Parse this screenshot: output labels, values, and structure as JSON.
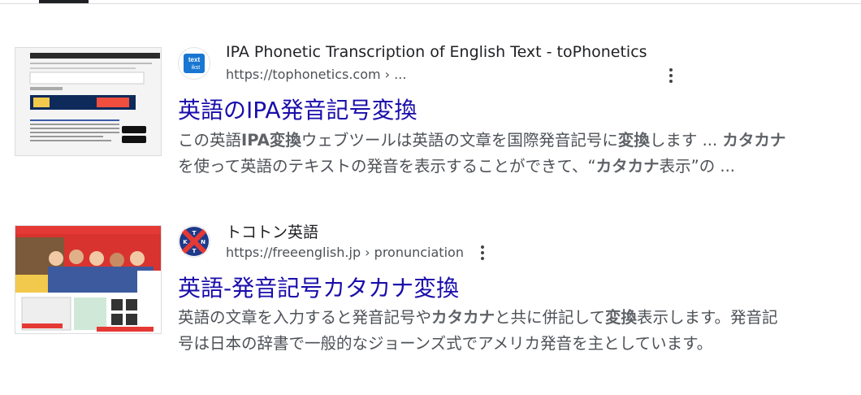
{
  "results": [
    {
      "site_name": "IPA Phonetic Transcription of English Text - toPhonetics",
      "url": "https://tophonetics.com › ...",
      "title": "英語のIPA発音記号変換",
      "favicon_text_top": "text",
      "favicon_text_bottom": "ikst",
      "snippet_line1": [
        {
          "t": "この英語",
          "b": false
        },
        {
          "t": "IPA変換",
          "b": true
        },
        {
          "t": "ウェブツールは英語の文章を国際発音記号に",
          "b": false
        },
        {
          "t": "変換",
          "b": true
        },
        {
          "t": "します ... ",
          "b": false
        },
        {
          "t": "カタカナ",
          "b": true
        }
      ],
      "snippet_line2": [
        {
          "t": "を使って英語のテキストの発音を表示することができて、“",
          "b": false
        },
        {
          "t": "カタカナ",
          "b": true
        },
        {
          "t": "表示”の ...",
          "b": false
        }
      ],
      "thumbnail_icon": "website-screenshot"
    },
    {
      "site_name": "トコトン英語",
      "url": "https://freeenglish.jp › pronunciation",
      "title": "英語-発音記号カタカナ変換",
      "favicon_letters": [
        "T",
        "K",
        "N",
        "T"
      ],
      "snippet_line1": [
        {
          "t": "英語の文章を入力すると発音記号や",
          "b": false
        },
        {
          "t": "カタカナ",
          "b": true
        },
        {
          "t": "と共に併記して",
          "b": false
        },
        {
          "t": "変換",
          "b": true
        },
        {
          "t": "表示します。発音記",
          "b": false
        }
      ],
      "snippet_line2": [
        {
          "t": "号は日本の辞書で一般的なジョーンズ式でアメリカ発音を主としています。",
          "b": false
        }
      ],
      "thumbnail_icon": "website-screenshot-students"
    }
  ],
  "colors": {
    "title_link": "#1a0dab",
    "snippet": "#4d5156",
    "favicon1_bg": "#1976d2",
    "favicon2_red": "#e53935",
    "favicon2_blue": "#1e3a8a"
  }
}
